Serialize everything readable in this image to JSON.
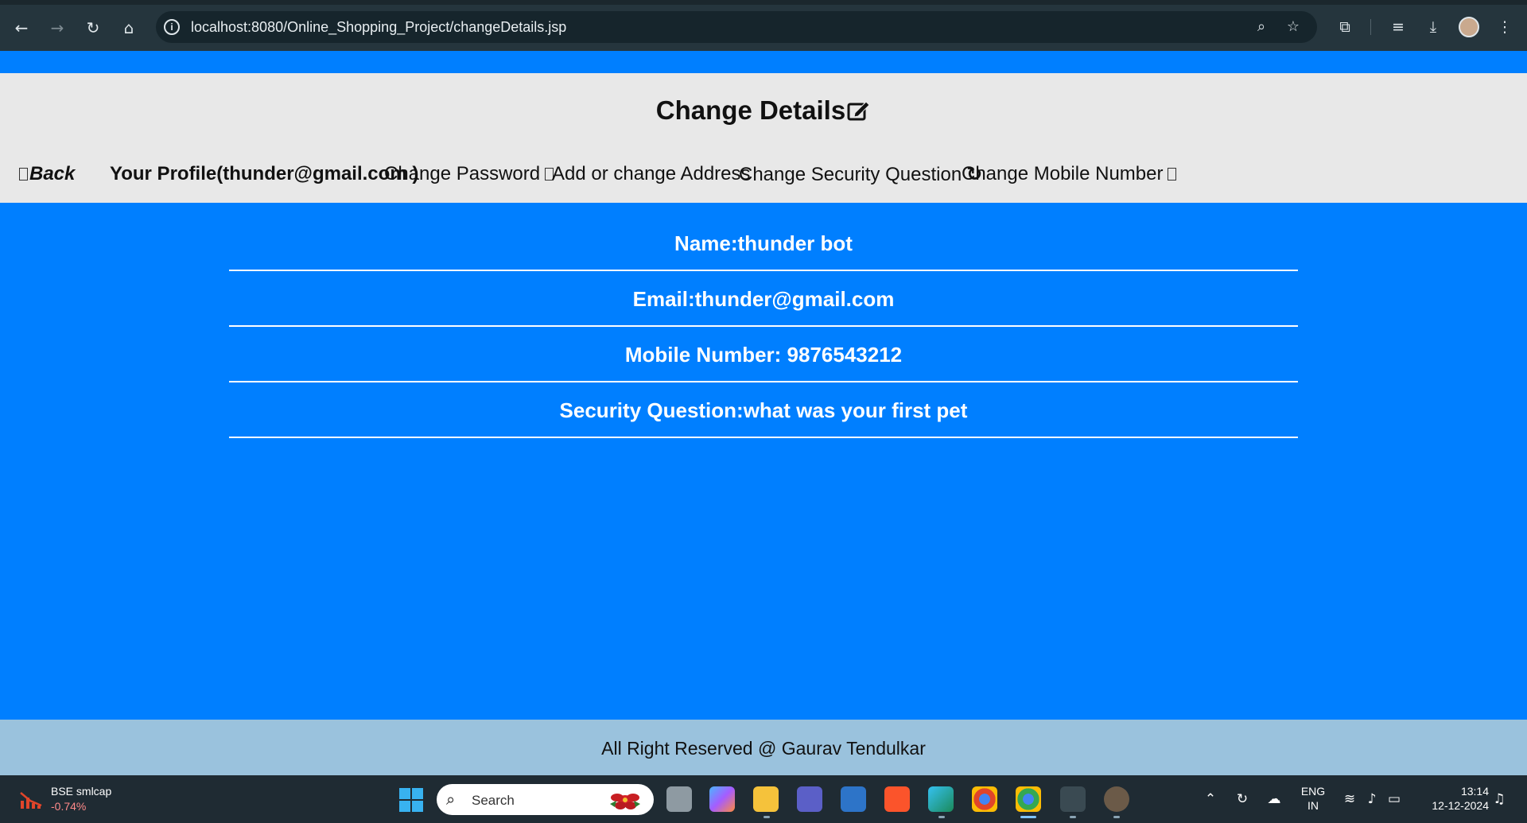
{
  "browser": {
    "url": "localhost:8080/Online_Shopping_Project/changeDetails.jsp",
    "icons": [
      "back-icon",
      "forward-icon",
      "reload-icon",
      "home-icon",
      "site-info-icon",
      "zoom-icon",
      "bookmark-star-icon",
      "extensions-icon",
      "media-icon",
      "download-icon",
      "profile-avatar",
      "menu-icon"
    ]
  },
  "header": {
    "title": "Change Details"
  },
  "menu": {
    "back": "Back",
    "profile": "Your Profile(thunder@gmail.com )",
    "change_password": "Change Password",
    "address": "Add or change Address",
    "security_question": "Change Security Question",
    "mobile": "Change Mobile Number"
  },
  "details": {
    "name": "Name:thunder bot",
    "email": "Email:thunder@gmail.com",
    "mobile": "Mobile Number: 9876543212",
    "security_question": "Security Question:what was your first pet"
  },
  "footer": {
    "text": "All Right Reserved @ Gaurav Tendulkar"
  },
  "taskbar": {
    "widget_title": "BSE smlcap",
    "widget_value": "-0.74%",
    "search_placeholder": "Search",
    "lang_line1": "ENG",
    "lang_line2": "IN",
    "time": "13:14",
    "date": "12-12-2024"
  },
  "colors": {
    "page_blue": "#007fff",
    "header_gray": "#e8e8e8",
    "footer_blue": "#9ac2dd",
    "chrome_dark": "#25353d",
    "taskbar": "#1f2b33"
  }
}
